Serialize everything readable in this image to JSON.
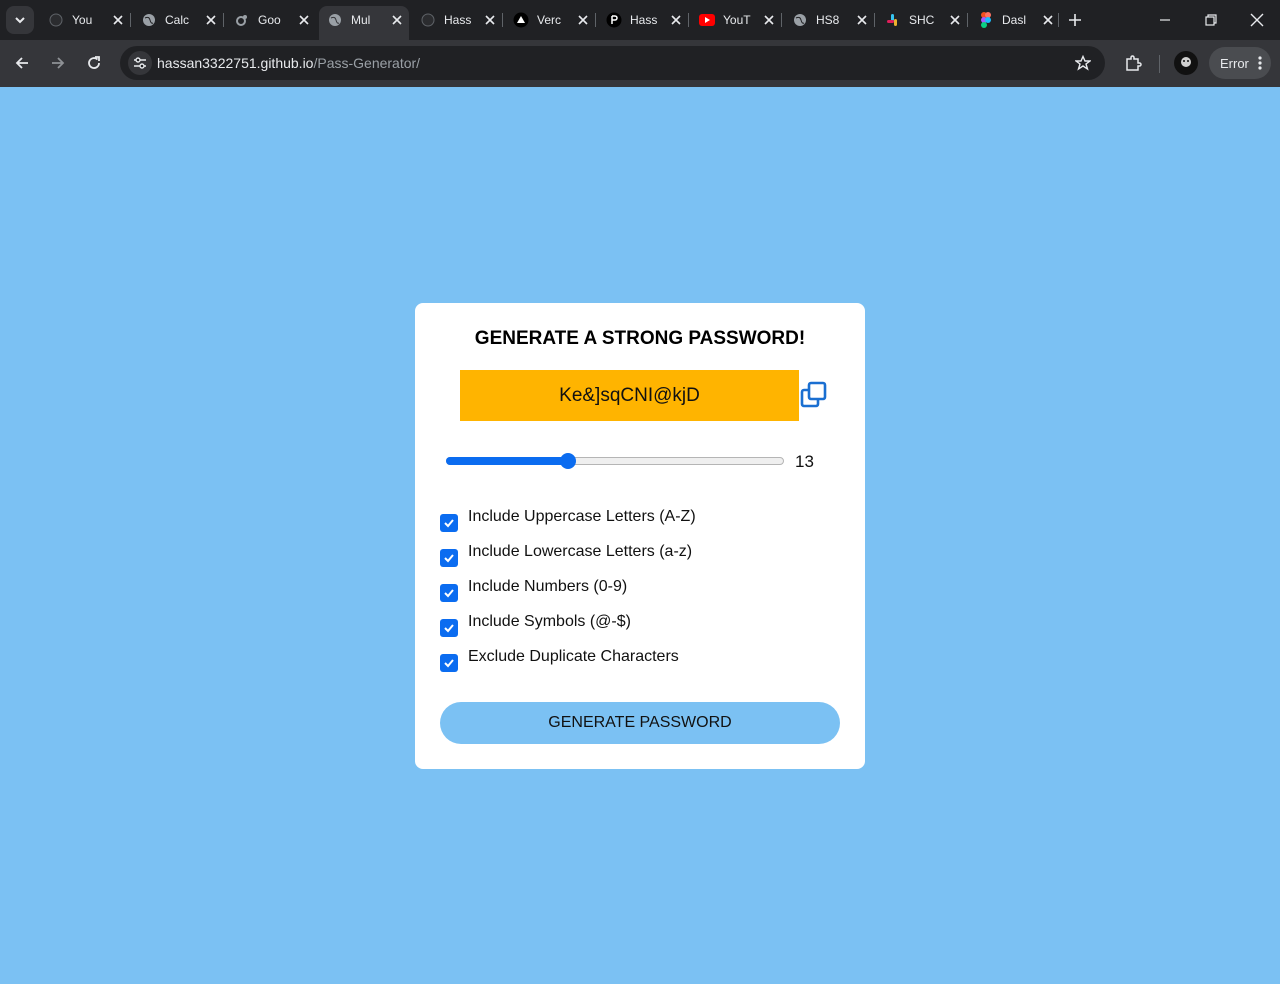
{
  "browser": {
    "tabs": [
      {
        "title": "You",
        "favicon": "github-icon"
      },
      {
        "title": "Calc",
        "favicon": "globe-icon"
      },
      {
        "title": "Goo",
        "favicon": "google-colab-icon"
      },
      {
        "title": "Mul",
        "favicon": "globe-icon",
        "active": true
      },
      {
        "title": "Hass",
        "favicon": "github-icon"
      },
      {
        "title": "Verc",
        "favicon": "vercel-icon"
      },
      {
        "title": "Hass",
        "favicon": "p-icon"
      },
      {
        "title": "YouT",
        "favicon": "youtube-icon"
      },
      {
        "title": "HS8",
        "favicon": "globe-icon"
      },
      {
        "title": "SHC",
        "favicon": "slack-icon"
      },
      {
        "title": "Dasl",
        "favicon": "figma-icon"
      }
    ],
    "address": {
      "host": "hassan3322751.github.io",
      "path": "/Pass-Generator/"
    },
    "error_label": "Error"
  },
  "generator": {
    "heading": "GENERATE A STRONG PASSWORD!",
    "password": "Ke&]sqCNI@kjD",
    "length": {
      "value": 13,
      "min": 1,
      "max": 35
    },
    "options": [
      {
        "label": "Include Uppercase Letters (A-Z)",
        "checked": true
      },
      {
        "label": "Include Lowercase Letters (a-z)",
        "checked": true
      },
      {
        "label": "Include Numbers (0-9)",
        "checked": true
      },
      {
        "label": "Include Symbols (@-$)",
        "checked": true
      },
      {
        "label": "Exclude Duplicate Characters",
        "checked": true
      }
    ],
    "button_label": "GENERATE PASSWORD"
  },
  "colors": {
    "page_background": "#7bc1f3",
    "password_box": "#ffb400",
    "accent": "#0b6cf0"
  }
}
